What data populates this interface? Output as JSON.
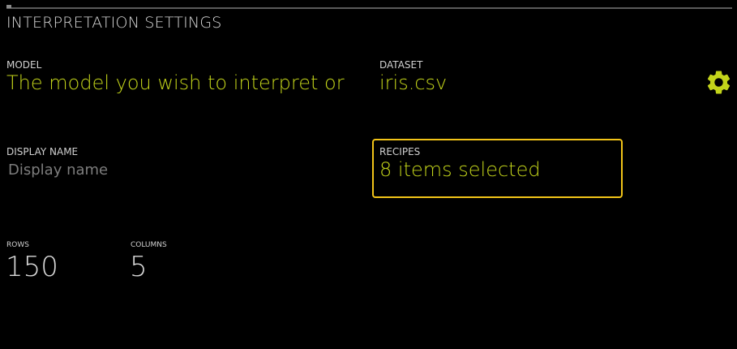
{
  "header": {
    "title": "INTERPRETATION SETTINGS"
  },
  "model": {
    "label": "MODEL",
    "value": "The model you wish to interpret or"
  },
  "dataset": {
    "label": "DATASET",
    "value": "iris.csv"
  },
  "display_name": {
    "label": "DISPLAY NAME",
    "placeholder": "Display name",
    "value": ""
  },
  "recipes": {
    "label": "RECIPES",
    "value": "8 items selected"
  },
  "stats": {
    "rows_label": "ROWS",
    "rows_value": "150",
    "columns_label": "COLUMNS",
    "columns_value": "5"
  },
  "icons": {
    "settings": "gear-icon"
  },
  "colors": {
    "accent": "#c3d41a",
    "focus_border": "#f2c418",
    "background": "#000000"
  }
}
